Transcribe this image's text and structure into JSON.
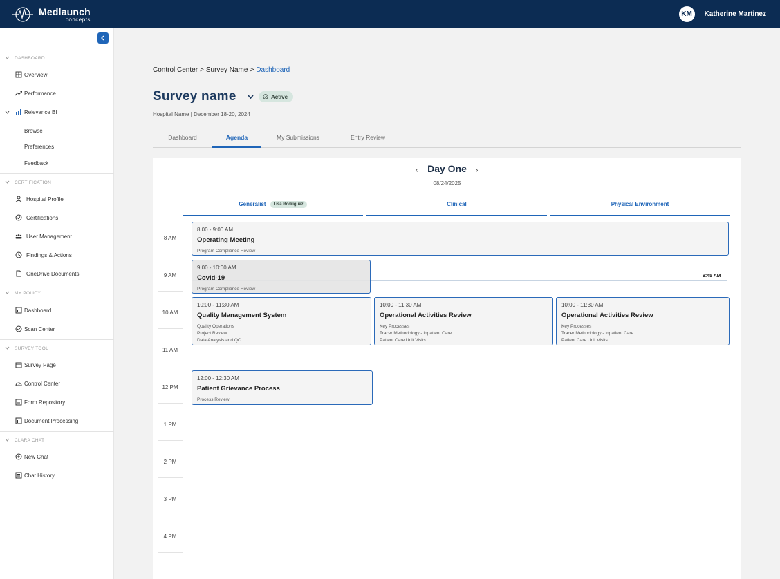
{
  "header": {
    "logo_main": "Medlaunch",
    "logo_sub": "concepts",
    "avatar_initials": "KM",
    "user_name": "Katherine Martinez"
  },
  "sidebar": {
    "sections": [
      {
        "label": "DASHBOARD",
        "items": [
          "Overview",
          "Performance",
          "Relevance BI"
        ],
        "subitems": [
          "Browse",
          "Preferences",
          "Feedback"
        ]
      },
      {
        "label": "CERTIFICATION",
        "items": [
          "Hospital Profile",
          "Certifications",
          "User Management",
          "Findings & Actions",
          "OneDrive Documents"
        ]
      },
      {
        "label": "MY POLICY",
        "items": [
          "Dashboard",
          "Scan Center"
        ]
      },
      {
        "label": "SURVEY TOOL",
        "items": [
          "Survey Page",
          "Control Center",
          "Form Repository",
          "Document Processing"
        ]
      },
      {
        "label": "CLARA CHAT",
        "items": [
          "New Chat",
          "Chat History"
        ]
      }
    ]
  },
  "breadcrumb": {
    "items": [
      "Control Center",
      "Survey Name"
    ],
    "current": "Dashboard",
    "separator": ">"
  },
  "survey": {
    "title": "Survey name",
    "status": "Active",
    "subtitle": "Hospital Name | December 18-20, 2024"
  },
  "tabs": [
    {
      "label": "Dashboard",
      "active": false
    },
    {
      "label": "Agenda",
      "active": true
    },
    {
      "label": "My Submissions",
      "active": false
    },
    {
      "label": "Entry Review",
      "active": false
    }
  ],
  "agenda": {
    "day_title": "Day One",
    "day_date": "08/24/2025",
    "prev_glyph": "‹",
    "next_glyph": "›",
    "columns": [
      {
        "label": "Generalist",
        "person": "Lisa Rodriguez"
      },
      {
        "label": "Clinical"
      },
      {
        "label": "Physical Environment"
      }
    ],
    "hours": [
      "8 AM",
      "9 AM",
      "10 AM",
      "11 AM",
      "12 PM",
      "1 PM",
      "2 PM",
      "3 PM",
      "4 PM"
    ],
    "current_time": "9:45 AM",
    "events": [
      {
        "time": "8:00 - 9:00 AM",
        "title": "Operating Meeting",
        "details": [
          "Program Compliance Review"
        ]
      },
      {
        "time": "9:00 - 10:00 AM",
        "title": "Covid-19",
        "details": [
          "Program Compliance Review"
        ]
      },
      {
        "time": "10:00 - 11:30 AM",
        "title": "Quality Management System",
        "details": [
          "Quality Operations",
          "Project Review",
          "Data Analysis and QC"
        ]
      },
      {
        "time": "10:00 - 11:30 AM",
        "title": "Operational Activities Review",
        "details": [
          "Key Processes",
          "Tracer Methodology - Inpatient Care",
          "Patient Care Unit Visits"
        ]
      },
      {
        "time": "10:00 - 11:30 AM",
        "title": "Operational Activities Review",
        "details": [
          "Key Processes",
          "Tracer Methodology - Inpatient Care",
          "Patient Care Unit Visits"
        ]
      },
      {
        "time": "12:00 - 12:30 AM",
        "title": "Patient Grievance Process",
        "details": [
          "Process Review"
        ]
      }
    ]
  },
  "colors": {
    "navy": "#0c2c53",
    "accent": "#1f65b8",
    "badge_bg": "#d6e6df"
  }
}
